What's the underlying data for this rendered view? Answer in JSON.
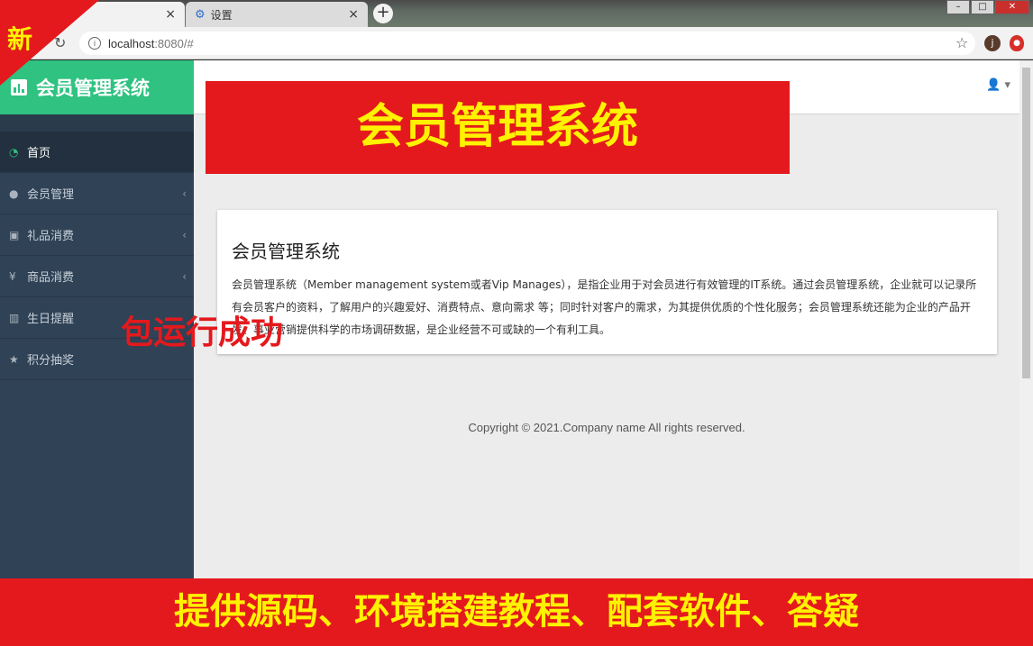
{
  "browser": {
    "tabs": [
      {
        "label": ""
      },
      {
        "label": "设置"
      }
    ],
    "url_host": "localhost",
    "url_rest": ":8080/#",
    "profile_initial": "j"
  },
  "ribbon": {
    "text": "新"
  },
  "app": {
    "brand": "会员管理系统",
    "menu": [
      {
        "label": "首页",
        "icon": "dashboard-icon"
      },
      {
        "label": "会员管理",
        "icon": "user-icon"
      },
      {
        "label": "礼品消费",
        "icon": "gift-icon"
      },
      {
        "label": "商品消费",
        "icon": "yen-icon"
      },
      {
        "label": "生日提醒",
        "icon": "bank-icon"
      },
      {
        "label": "积分抽奖",
        "icon": "star-icon"
      }
    ],
    "card": {
      "title": "会员管理系统",
      "body": "会员管理系统（Member management system或者Vip Manages），是指企业用于对会员进行有效管理的IT系统。通过会员管理系统，企业就可以记录所有会员客户的资料，了解用户的兴趣爱好、消费特点、意向需求 等；同时针对客户的需求，为其提供优质的个性化服务；会员管理系统还能为企业的产品开发、事业营销提供科学的市场调研数据，是企业经营不可或缺的一个有利工具。"
    },
    "copyright": "Copyright © 2021.Company name All rights reserved."
  },
  "overlays": {
    "banner": "会员管理系统",
    "float": "包运行成功",
    "bottom": "提供源码、环境搭建教程、配套软件、答疑"
  },
  "colors": {
    "accent": "#2fc281",
    "sidebar": "#2f4256",
    "promo_red": "#e4191d",
    "promo_yellow": "#fff200"
  }
}
